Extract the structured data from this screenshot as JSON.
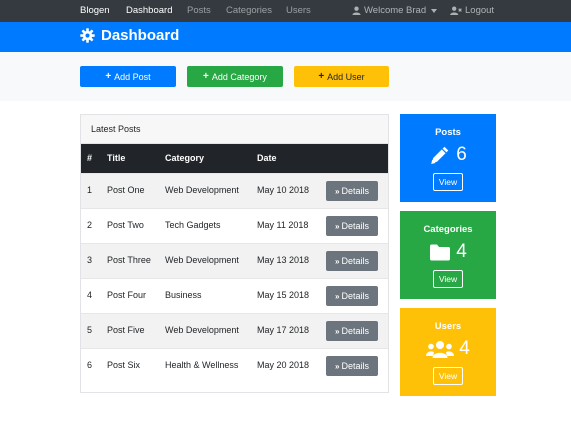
{
  "nav": {
    "brand": "Blogen",
    "links": [
      "Dashboard",
      "Posts",
      "Categories",
      "Users"
    ],
    "user_label": "Welcome Brad",
    "logout_label": "Logout"
  },
  "header": {
    "title": "Dashboard"
  },
  "actions": {
    "add_post": "Add Post",
    "add_category": "Add Category",
    "add_user": "Add User"
  },
  "posts_card": {
    "title": "Latest Posts",
    "columns": [
      "#",
      "Title",
      "Category",
      "Date"
    ],
    "rows": [
      {
        "num": "1",
        "title": "Post One",
        "category": "Web Development",
        "date": "May 10 2018",
        "action": "Details"
      },
      {
        "num": "2",
        "title": "Post Two",
        "category": "Tech Gadgets",
        "date": "May 11 2018",
        "action": "Details"
      },
      {
        "num": "3",
        "title": "Post Three",
        "category": "Web Development",
        "date": "May 13 2018",
        "action": "Details"
      },
      {
        "num": "4",
        "title": "Post Four",
        "category": "Business",
        "date": "May 15 2018",
        "action": "Details"
      },
      {
        "num": "5",
        "title": "Post Five",
        "category": "Web Development",
        "date": "May 17 2018",
        "action": "Details"
      },
      {
        "num": "6",
        "title": "Post Six",
        "category": "Health & Wellness",
        "date": "May 20 2018",
        "action": "Details"
      }
    ]
  },
  "stats": {
    "posts": {
      "title": "Posts",
      "value": "6",
      "button": "View",
      "icon": "pencil-icon",
      "color": "#007bff"
    },
    "categories": {
      "title": "Categories",
      "value": "4",
      "button": "View",
      "icon": "folder-icon",
      "color": "#28a745"
    },
    "users": {
      "title": "Users",
      "value": "4",
      "button": "View",
      "icon": "users-icon",
      "color": "#ffc107"
    }
  },
  "colors": {
    "primary": "#007bff",
    "success": "#28a745",
    "warning": "#ffc107",
    "dark": "#343a40",
    "secondary": "#6c757d"
  }
}
